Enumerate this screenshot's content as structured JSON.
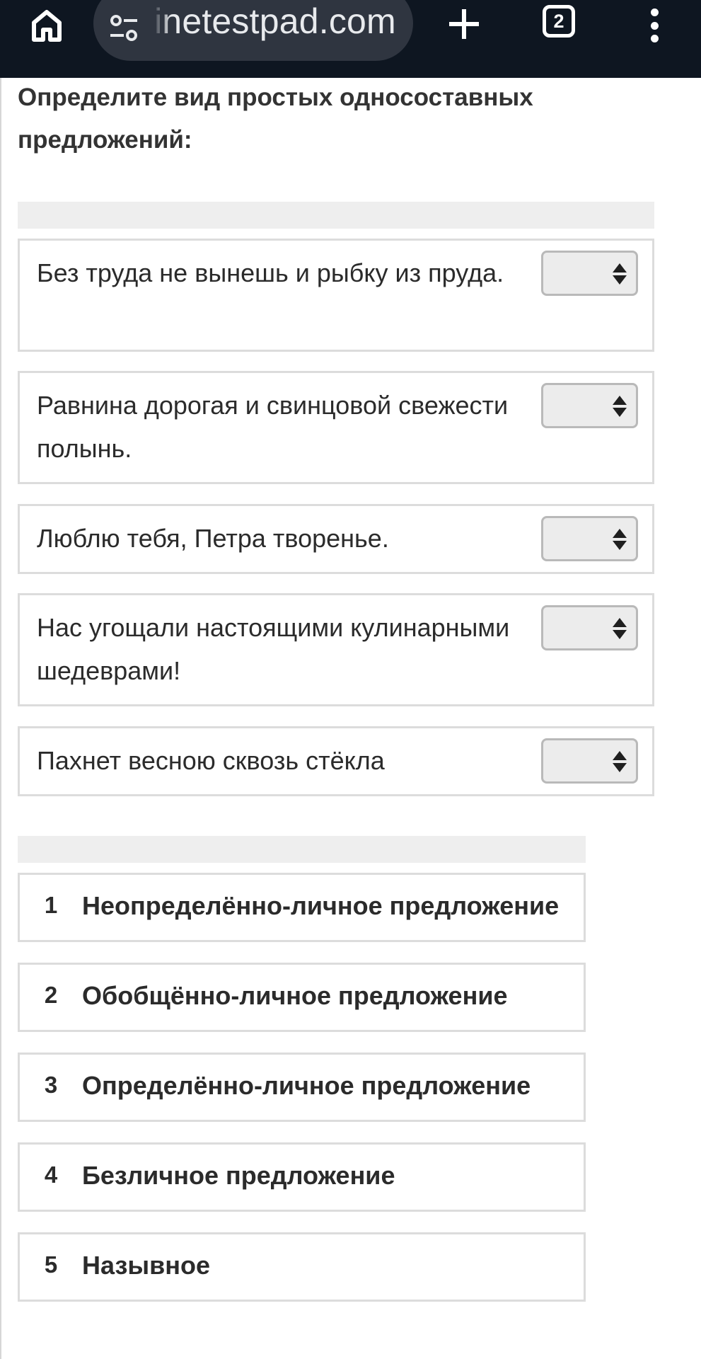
{
  "browser": {
    "url": "inetestpad.com",
    "tab_count": "2",
    "icons": [
      "home-icon",
      "site-settings-icon",
      "new-tab-plus-icon",
      "tab-switcher-icon",
      "more-menu-icon"
    ]
  },
  "question": {
    "title": "Определите вид простых односоставных предложений:"
  },
  "sentences": [
    {
      "text": "Без труда не вынешь и рыбку из пруда.",
      "selected": ""
    },
    {
      "text": "Равнина дорогая и свинцовой свежести полынь.",
      "selected": ""
    },
    {
      "text": "Люблю тебя, Петра творенье.",
      "selected": ""
    },
    {
      "text": "Нас угощали настоящими кулинарными шедеврами!",
      "selected": ""
    },
    {
      "text": "Пахнет весною сквозь стёкла",
      "selected": ""
    }
  ],
  "answers": [
    {
      "num": "1",
      "label": "Неопределённо-личное предложение"
    },
    {
      "num": "2",
      "label": "Обобщённо-личное предложение"
    },
    {
      "num": "3",
      "label": "Определённо-личное предложение"
    },
    {
      "num": "4",
      "label": "Безличное предложение"
    },
    {
      "num": "5",
      "label": "Назывное"
    }
  ],
  "colors": {
    "toolbar_bg": "#0e1621",
    "urlbar_bg": "#2f3540",
    "row_border": "#dcdcdc",
    "strip_bg": "#eeeeee",
    "select_bg": "#ececec"
  }
}
